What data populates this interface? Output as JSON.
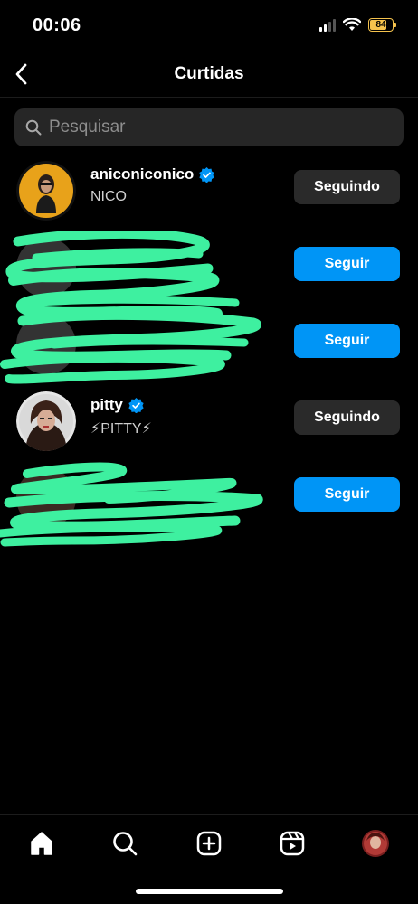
{
  "status_bar": {
    "time": "00:06",
    "battery": "84"
  },
  "header": {
    "title": "Curtidas"
  },
  "search": {
    "placeholder": "Pesquisar"
  },
  "users": [
    {
      "username": "aniconiconico",
      "verified": true,
      "full_name": "NICO",
      "button": "Seguindo",
      "button_style": "following",
      "redacted": false
    },
    {
      "username": "",
      "verified": false,
      "full_name": "",
      "button": "Seguir",
      "button_style": "follow",
      "redacted": true
    },
    {
      "username": "",
      "verified": false,
      "full_name": "",
      "button": "Seguir",
      "button_style": "follow",
      "redacted": true
    },
    {
      "username": "pitty",
      "verified": true,
      "full_name": "⚡PITTY⚡",
      "button": "Seguindo",
      "button_style": "following",
      "redacted": false
    },
    {
      "username": "",
      "verified": false,
      "full_name": "",
      "button": "Seguir",
      "button_style": "follow",
      "redacted": true
    }
  ],
  "colors": {
    "follow": "#0095f6",
    "following": "#2a2a2a",
    "verified": "#0095f6",
    "redaction": "#3ef0a0",
    "battery": "#f5c34d"
  },
  "tabbar": {
    "items": [
      "home-icon",
      "search-icon",
      "create-icon",
      "reels-icon",
      "profile-avatar"
    ]
  }
}
